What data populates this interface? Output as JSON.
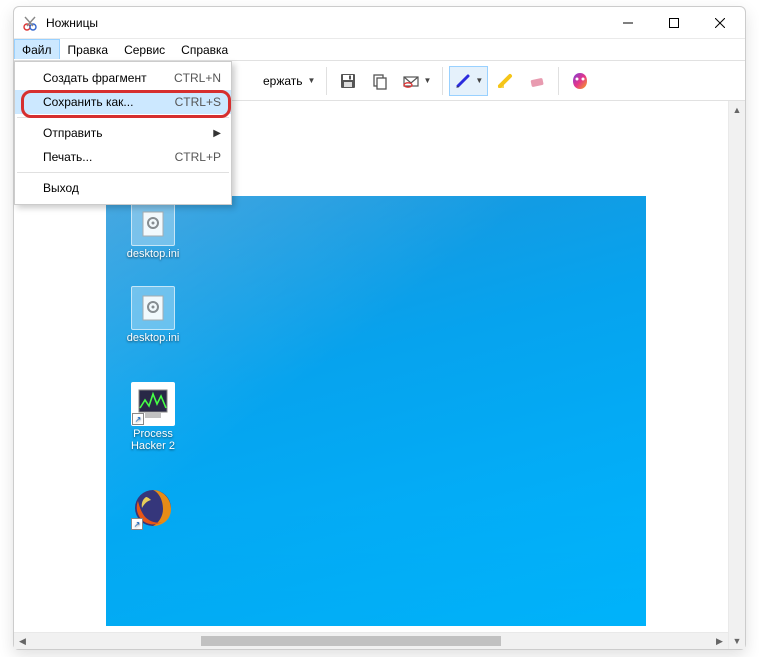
{
  "window": {
    "title": "Ножницы"
  },
  "menubar": {
    "items": [
      {
        "label": "Файл",
        "active": true
      },
      {
        "label": "Правка"
      },
      {
        "label": "Сервис"
      },
      {
        "label": "Справка"
      }
    ]
  },
  "file_menu": {
    "items": [
      {
        "label": "Создать фрагмент",
        "shortcut": "CTRL+N"
      },
      {
        "label": "Сохранить как...",
        "shortcut": "CTRL+S",
        "highlight": true
      },
      {
        "label": "Отправить",
        "submenu": true
      },
      {
        "label": "Печать...",
        "shortcut": "CTRL+P"
      },
      {
        "label": "Выход"
      }
    ]
  },
  "toolbar": {
    "delay_suffix": "ержать"
  },
  "desktop": {
    "icons": [
      {
        "label": "desktop.ini"
      },
      {
        "label": "desktop.ini"
      },
      {
        "label_partial": "e",
        "label": "Process\nHacker 2"
      },
      {
        "label": ""
      }
    ]
  }
}
